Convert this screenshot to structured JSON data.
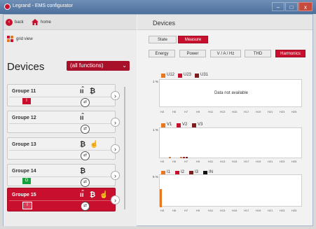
{
  "window": {
    "title": "Legrand - EMS configurator",
    "minimize": "–",
    "maximize": "□",
    "close": "x"
  },
  "nav": {
    "back": "back",
    "home": "home",
    "grid_view": "grid view"
  },
  "left": {
    "title": "Devices",
    "filter": "(all functions)"
  },
  "groups": [
    {
      "name": "Groupe 11",
      "badge": "I",
      "badge_color": "red",
      "plug": "⇄"
    },
    {
      "name": "Groupe 12",
      "badge": "",
      "badge_color": "",
      "plug": "⇄"
    },
    {
      "name": "Groupe 13",
      "badge": "",
      "badge_color": "",
      "plug": "⇄"
    },
    {
      "name": "Groupe 14",
      "badge": "O",
      "badge_color": "green",
      "plug": "⇄"
    },
    {
      "name": "Groupe 15",
      "badge": "I",
      "badge_color": "red",
      "plug": "⇄",
      "selected": true
    }
  ],
  "right": {
    "title": "Devices",
    "tabs": [
      "State",
      "Measure"
    ],
    "active_tab": "Measure",
    "subtabs": [
      "Energy",
      "Power",
      "V / A / Hz",
      "THD",
      "Harmonics"
    ],
    "active_subtab": "Harmonics"
  },
  "charts": [
    {
      "pct": "1 %",
      "legend": [
        "U12",
        "U23",
        "U31"
      ],
      "message": "Data not available",
      "ticks": [
        "H3",
        "H5",
        "H7",
        "H9",
        "H11",
        "H13",
        "H15",
        "H17",
        "H19",
        "H21",
        "H23",
        "H25"
      ]
    },
    {
      "pct": "1 %",
      "legend": [
        "V1",
        "V2",
        "V3"
      ],
      "ticks": [
        "H3",
        "H5",
        "H7",
        "H9",
        "H11",
        "H13",
        "H15",
        "H17",
        "H19",
        "H21",
        "H23",
        "H25"
      ]
    },
    {
      "pct": "5 %",
      "legend": [
        "I1",
        "I2",
        "I3",
        "IN"
      ],
      "ticks": [
        "H3",
        "H5",
        "H7",
        "H9",
        "H11",
        "H13",
        "H15",
        "H17",
        "H19",
        "H21",
        "H23",
        "H25"
      ]
    }
  ],
  "colors": {
    "brand": "#c8102e",
    "series1": "#e87722",
    "series2": "#c8102e",
    "series3": "#7b1f1f",
    "series4": "#111111"
  }
}
